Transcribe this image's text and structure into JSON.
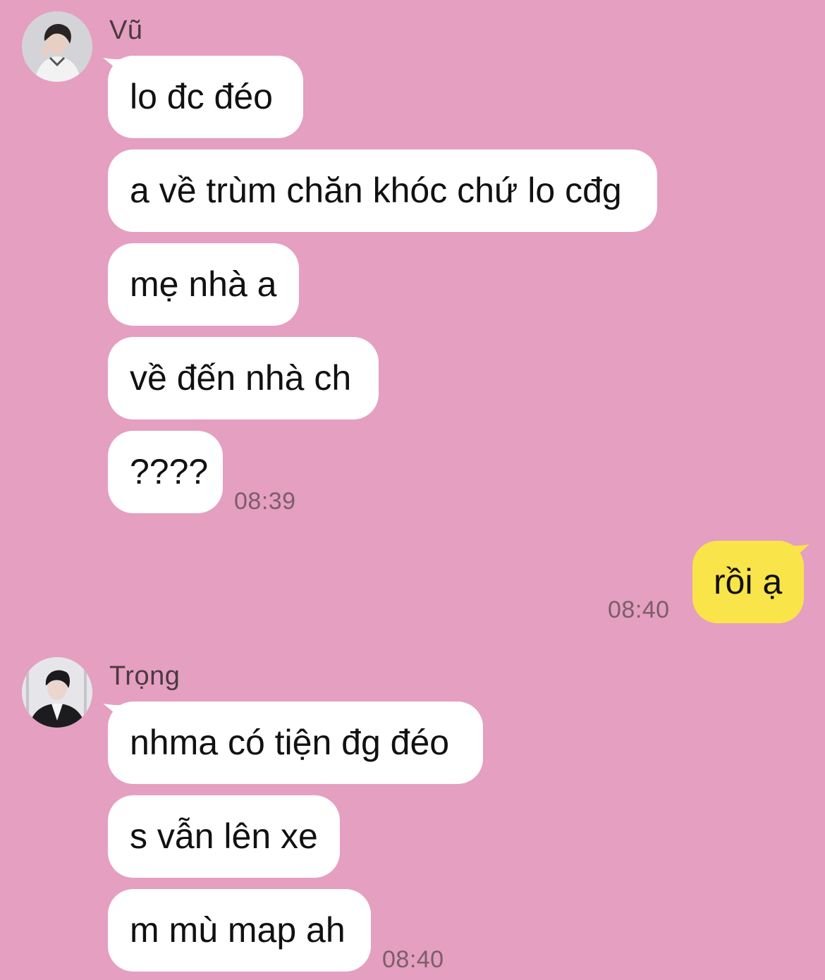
{
  "chat": {
    "background_color": "#e59fc0",
    "groups": [
      {
        "sender": "Vũ",
        "avatar_icon": "user-avatar-photo",
        "messages": [
          "lo đc đéo",
          "a về trùm chăn khóc chứ lo cđg",
          "mẹ nhà a",
          "về đến nhà ch",
          "????"
        ],
        "time": "08:39"
      },
      {
        "sender": "me",
        "messages": [
          "rồi ạ"
        ],
        "time": "08:40",
        "bubble_color": "#f9e44a"
      },
      {
        "sender": "Trọng",
        "avatar_icon": "user-avatar-photo",
        "messages": [
          "nhma có tiện đg đéo",
          "s vẫn lên xe",
          "m mù map ah"
        ],
        "time": "08:40"
      }
    ]
  }
}
